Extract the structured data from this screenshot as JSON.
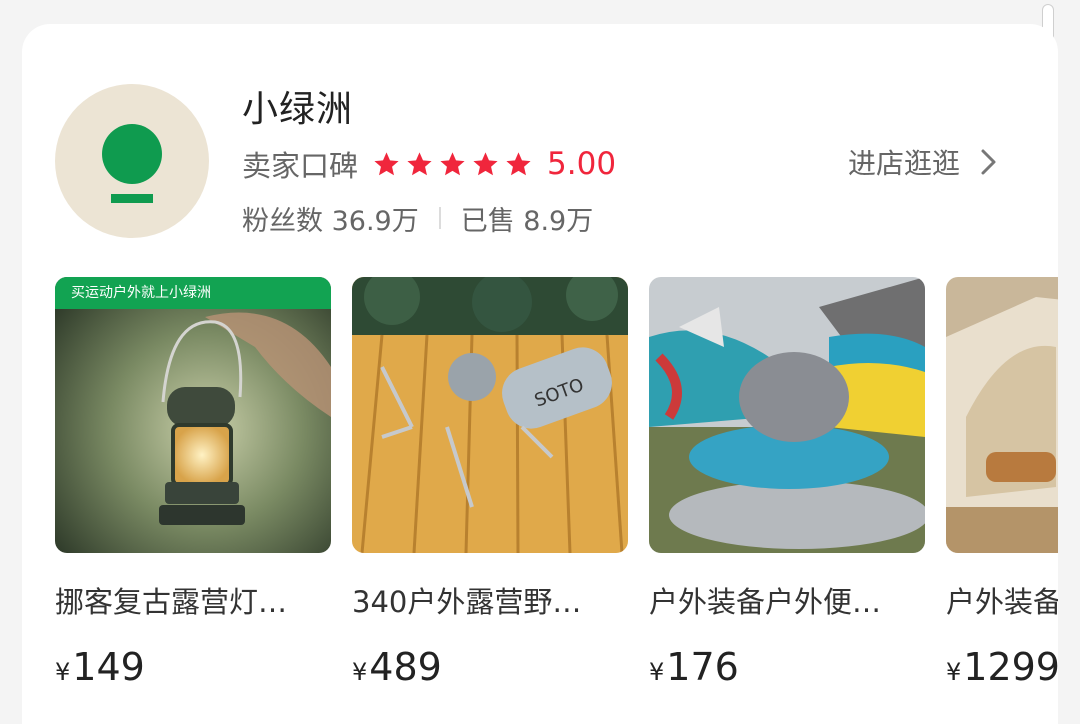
{
  "shop": {
    "name": "小绿洲",
    "rating_label": "卖家口碑",
    "rating_stars": 5,
    "rating_value": "5.00",
    "followers": "粉丝数 36.9万",
    "sold": "已售 8.9万",
    "visit_label": "进店逛逛",
    "icons": {
      "avatar": "shop-logo-icon",
      "star": "star-icon",
      "chevron": "chevron-right-icon"
    }
  },
  "products": [
    {
      "banner": "买运动户外就上小绿洲",
      "title": "挪客复古露营灯…",
      "currency": "¥",
      "price": "149"
    },
    {
      "title": "340户外露营野…",
      "currency": "¥",
      "price": "489"
    },
    {
      "title": "户外装备户外便…",
      "currency": "¥",
      "price": "176"
    },
    {
      "title": "户外装备",
      "currency": "¥",
      "price": "1299"
    }
  ],
  "colors": {
    "brand_green": "#0f9b4f",
    "rating_red": "#f0263c",
    "avatar_bg": "#ece4d4"
  }
}
